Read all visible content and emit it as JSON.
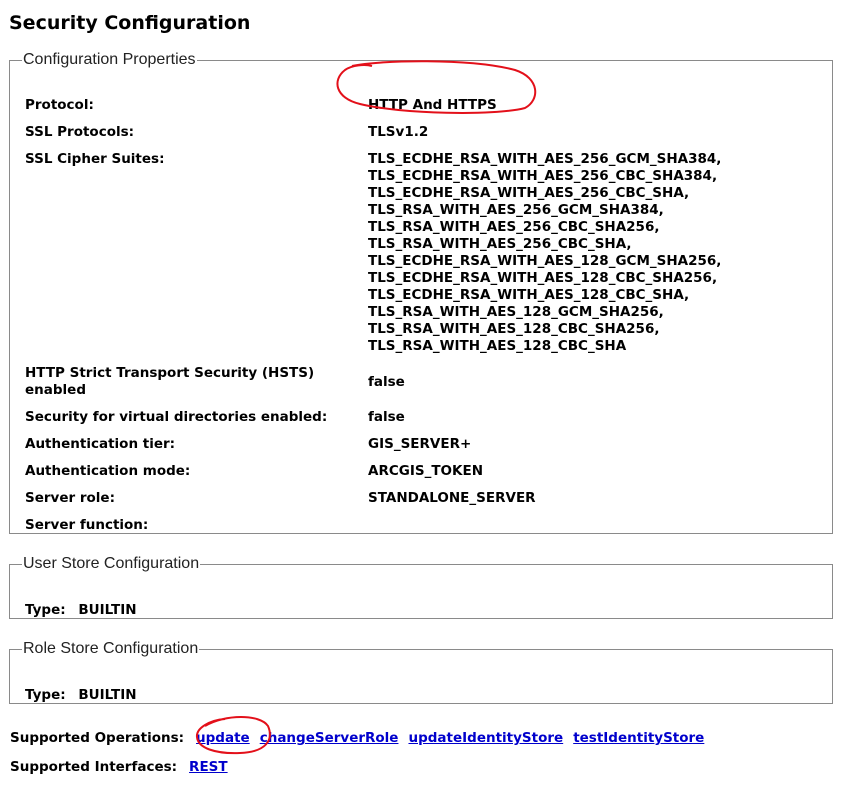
{
  "page": {
    "title": "Security Configuration"
  },
  "config": {
    "legend": "Configuration Properties",
    "protocol": {
      "label": "Protocol:",
      "value": "HTTP And HTTPS"
    },
    "ssl_protocols": {
      "label": "SSL Protocols:",
      "value": "TLSv1.2"
    },
    "cipher_suites": {
      "label": "SSL Cipher Suites:",
      "values": [
        "TLS_ECDHE_RSA_WITH_AES_256_GCM_SHA384,",
        "TLS_ECDHE_RSA_WITH_AES_256_CBC_SHA384,",
        "TLS_ECDHE_RSA_WITH_AES_256_CBC_SHA,",
        "TLS_RSA_WITH_AES_256_GCM_SHA384,",
        "TLS_RSA_WITH_AES_256_CBC_SHA256,",
        "TLS_RSA_WITH_AES_256_CBC_SHA,",
        "TLS_ECDHE_RSA_WITH_AES_128_GCM_SHA256,",
        "TLS_ECDHE_RSA_WITH_AES_128_CBC_SHA256,",
        "TLS_ECDHE_RSA_WITH_AES_128_CBC_SHA,",
        "TLS_RSA_WITH_AES_128_GCM_SHA256,",
        "TLS_RSA_WITH_AES_128_CBC_SHA256,",
        "TLS_RSA_WITH_AES_128_CBC_SHA"
      ]
    },
    "hsts": {
      "label_line1": "HTTP Strict Transport Security (HSTS)",
      "label_line2": "enabled",
      "value": "false"
    },
    "virtual_dirs": {
      "label": "Security for virtual directories enabled:",
      "value": "false"
    },
    "auth_tier": {
      "label": "Authentication tier:",
      "value": "GIS_SERVER+"
    },
    "auth_mode": {
      "label": "Authentication mode:",
      "value": "ARCGIS_TOKEN"
    },
    "server_role": {
      "label": "Server role:",
      "value": "STANDALONE_SERVER"
    },
    "server_function": {
      "label": "Server function:",
      "value": ""
    }
  },
  "user_store": {
    "legend": "User Store Configuration",
    "type_label": "Type:",
    "type_value": "BUILTIN"
  },
  "role_store": {
    "legend": "Role Store Configuration",
    "type_label": "Type:",
    "type_value": "BUILTIN"
  },
  "operations": {
    "label": "Supported Operations:",
    "links": [
      "update",
      "changeServerRole",
      "updateIdentityStore",
      "testIdentityStore"
    ]
  },
  "interfaces": {
    "label": "Supported Interfaces:",
    "links": [
      "REST"
    ]
  },
  "annotation_color": "#e3101a",
  "link_color": "#0000cc"
}
